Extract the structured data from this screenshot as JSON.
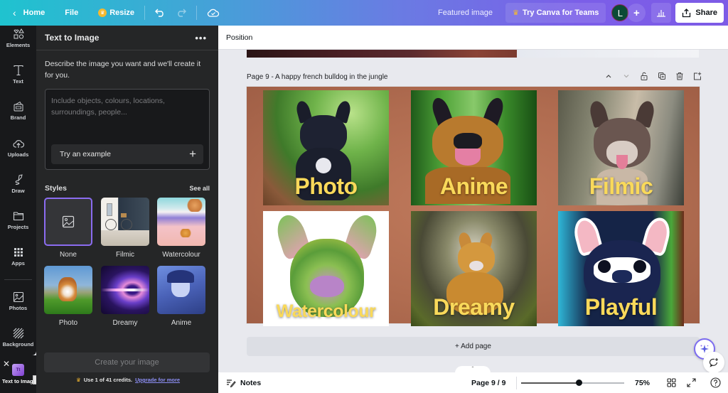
{
  "topbar": {
    "home_label": "Home",
    "file_label": "File",
    "resize_label": "Resize",
    "design_title": "Featured image",
    "teams_label": "Try Canva for Teams",
    "avatar_initial": "L",
    "share_label": "Share",
    "gradient_colors": [
      "#1fc3cf",
      "#7d5be6"
    ]
  },
  "rail": {
    "items": [
      {
        "label": "Elements",
        "icon": "elements-icon"
      },
      {
        "label": "Text",
        "icon": "text-icon"
      },
      {
        "label": "Brand",
        "icon": "brand-icon"
      },
      {
        "label": "Uploads",
        "icon": "uploads-icon"
      },
      {
        "label": "Draw",
        "icon": "draw-icon"
      },
      {
        "label": "Projects",
        "icon": "folder-icon"
      },
      {
        "label": "Apps",
        "icon": "apps-grid-icon"
      },
      {
        "label": "Photos",
        "icon": "photos-icon"
      },
      {
        "label": "Background",
        "icon": "background-icon"
      }
    ],
    "open_app_label": "Text to Image",
    "tooltip": "Text to Image"
  },
  "panel": {
    "title": "Text to Image",
    "description": "Describe the image you want and we'll create it for you.",
    "prompt_placeholder": "Include objects, colours, locations, surroundings, people...",
    "prompt_value": "",
    "try_example_label": "Try an example",
    "styles_title": "Styles",
    "see_all_label": "See all",
    "styles": [
      {
        "label": "None",
        "selected": true
      },
      {
        "label": "Filmic",
        "selected": false
      },
      {
        "label": "Watercolour",
        "selected": false
      },
      {
        "label": "Photo",
        "selected": false
      },
      {
        "label": "Dreamy",
        "selected": false
      },
      {
        "label": "Anime",
        "selected": false
      }
    ],
    "create_label": "Create your image",
    "credits_text": "Use 1 of 41 credits.",
    "upgrade_label": "Upgrade for more",
    "accent_color": "#8b6cf0"
  },
  "editor": {
    "toolbar_label": "Position",
    "page_label": "Page 9 - A happy french bulldog in the jungle",
    "page_actions": [
      "move-up",
      "move-down",
      "lock",
      "duplicate",
      "delete",
      "add-page"
    ],
    "cards": [
      {
        "label": "Photo"
      },
      {
        "label": "Anime"
      },
      {
        "label": "Filmic"
      },
      {
        "label": "Watercolour"
      },
      {
        "label": "Dreamy"
      },
      {
        "label": "Playful"
      }
    ],
    "add_page_label": "+ Add page"
  },
  "bottombar": {
    "notes_label": "Notes",
    "page_indicator": "Page 9 / 9",
    "zoom_percent": 75,
    "zoom_label": "75%",
    "zoom_slider_fraction": 0.56
  }
}
